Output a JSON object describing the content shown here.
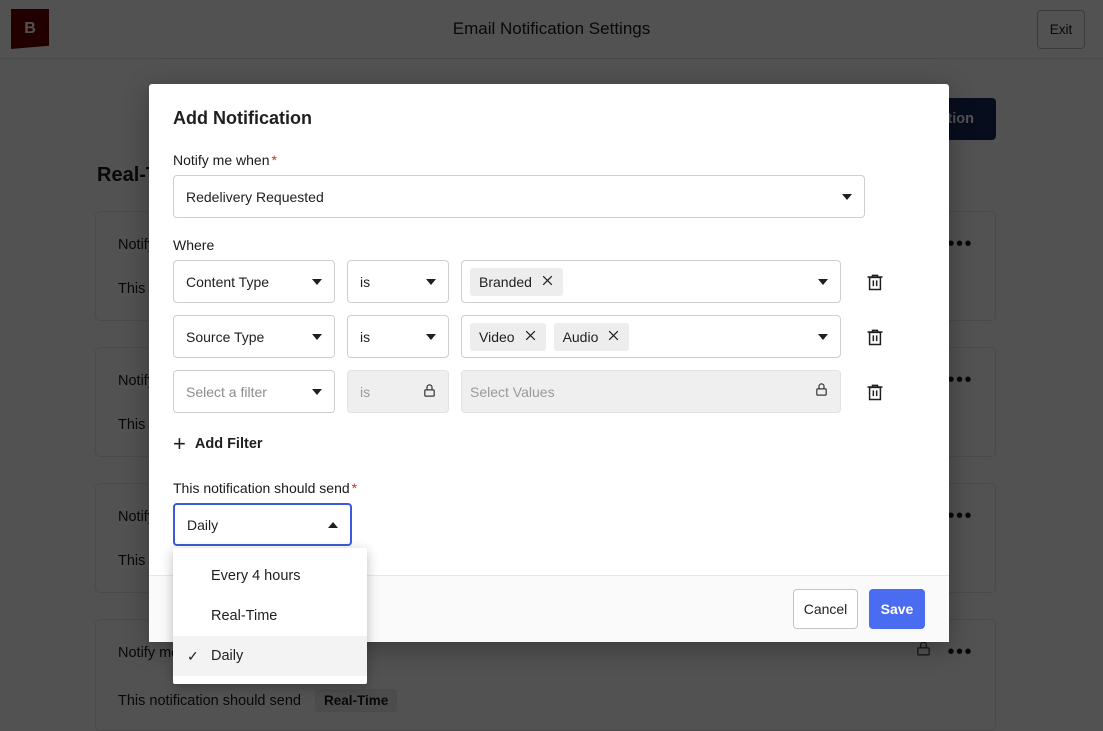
{
  "topbar": {
    "logo_text": "B",
    "title": "Email Notification Settings",
    "exit_label": "Exit"
  },
  "background": {
    "add_notification_label": "Add Notification",
    "section_title": "Real-Time",
    "cards": [
      {
        "line1": "Notify me when",
        "line2": "This notification should send",
        "badge": "",
        "locked": false
      },
      {
        "line1": "Notify me when",
        "line2": "This notification should send",
        "badge": "",
        "locked": false
      },
      {
        "line1": "Notify me when",
        "line2": "This notification should send",
        "badge": "",
        "locked": false
      },
      {
        "line1": "Notify me when",
        "line2": "This notification should send",
        "badge": "Real-Time",
        "locked": true
      }
    ],
    "menu_dots": "•••"
  },
  "modal": {
    "title": "Add Notification",
    "notify_label": "Notify me when",
    "required_mark": "*",
    "notify_value": "Redelivery Requested",
    "where_label": "Where",
    "filters": [
      {
        "field": "Content Type",
        "operator": "is",
        "values": [
          "Branded"
        ],
        "values_placeholder": "",
        "disabled": false
      },
      {
        "field": "Source Type",
        "operator": "is",
        "values": [
          "Video",
          "Audio"
        ],
        "values_placeholder": "",
        "disabled": false
      },
      {
        "field": "Select a filter",
        "operator": "is",
        "values": [],
        "values_placeholder": "Select Values",
        "disabled": true
      }
    ],
    "add_filter_label": "Add Filter",
    "add_filter_plus": "+",
    "send_label": "This notification should send",
    "send_value": "Daily",
    "send_options": [
      {
        "label": "Every 4 hours",
        "selected": false
      },
      {
        "label": "Real-Time",
        "selected": false
      },
      {
        "label": "Daily",
        "selected": true
      }
    ],
    "checkmark": "✓",
    "cancel_label": "Cancel",
    "save_label": "Save"
  },
  "colors": {
    "logo_bg": "#6b0000",
    "primary_button": "#4a6cf0",
    "secondary_button": "#1b2a5c",
    "focus_border": "#3b5bdb",
    "required": "#c0392b"
  }
}
